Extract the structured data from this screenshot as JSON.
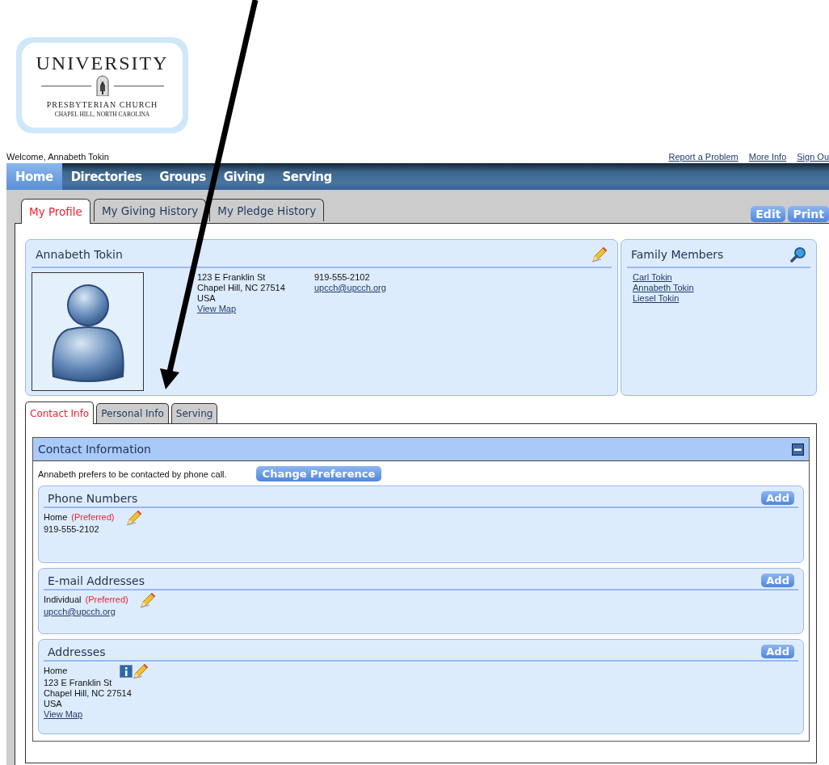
{
  "logo": {
    "title": "UNIVERSITY",
    "name": "PRESBYTERIAN CHURCH",
    "place": "CHAPEL HILL, NORTH CAROLINA"
  },
  "welcome": "Welcome, Annabeth Tokin",
  "top_links": [
    "Report a Problem",
    "More Info",
    "Sign Ou"
  ],
  "nav": [
    {
      "label": "Home",
      "selected": true
    },
    {
      "label": "Directories",
      "selected": false
    },
    {
      "label": "Groups",
      "selected": false
    },
    {
      "label": "Giving",
      "selected": false
    },
    {
      "label": "Serving",
      "selected": false
    }
  ],
  "tabs": [
    {
      "label": "My Profile",
      "selected": true
    },
    {
      "label": "My Giving History",
      "selected": false
    },
    {
      "label": "My Pledge History",
      "selected": false
    }
  ],
  "actions": [
    "Edit",
    "Print"
  ],
  "profile": {
    "name": "Annabeth Tokin",
    "address": [
      "123 E Franklin St",
      "Chapel Hill, NC 27514",
      "USA"
    ],
    "map_link": "View Map",
    "phone": "919-555-2102",
    "email": "upcch@upcch.org"
  },
  "family": {
    "title": "Family Members",
    "members": [
      "Carl Tokin",
      "Annabeth Tokin",
      "Liesel Tokin"
    ]
  },
  "subtabs": [
    {
      "label": "Contact Info",
      "selected": true
    },
    {
      "label": "Personal Info",
      "selected": false
    },
    {
      "label": "Serving",
      "selected": false
    }
  ],
  "contact": {
    "title": "Contact Information",
    "preference": "Annabeth prefers to be contacted by phone call.",
    "change_button": "Change Preference",
    "sections": [
      {
        "title": "Phone Numbers",
        "add": "Add",
        "entries": [
          {
            "kind": "phone",
            "label": "Home",
            "note": "(Preferred)",
            "lines": [
              "919-555-2102"
            ]
          }
        ]
      },
      {
        "title": "E-mail Addresses",
        "add": "Add",
        "entries": [
          {
            "kind": "email",
            "label": "Individual",
            "note": "(Preferred)",
            "link": "upcch@upcch.org"
          }
        ]
      },
      {
        "title": "Addresses",
        "add": "Add",
        "entries": [
          {
            "kind": "address",
            "label": "Home",
            "lines": [
              "123 E Franklin St",
              "Chapel Hill, NC 27514",
              "USA"
            ],
            "link": "View Map"
          }
        ]
      }
    ]
  }
}
